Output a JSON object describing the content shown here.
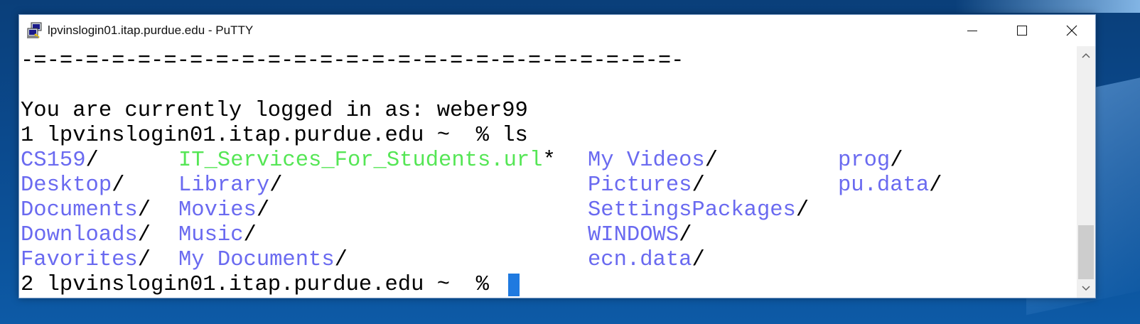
{
  "window": {
    "title": "lpvinslogin01.itap.purdue.edu - PuTTY"
  },
  "terminal": {
    "lines": [
      {
        "text": "-=-=-=-=-=-=-=-=-=-=-=-=-=-=-=-=-=-=-=-=-=-=-=-=-=-"
      },
      {
        "text": ""
      },
      {
        "text": "You are currently logged in as: weber99"
      },
      {
        "text": "1 lpvinslogin01.itap.purdue.edu ~  % ls"
      }
    ],
    "listing": [
      [
        "CS159",
        "IT_Services_For_Students.url",
        "My Videos",
        "prog"
      ],
      [
        "Desktop",
        "Library",
        "Pictures",
        "pu.data"
      ],
      [
        "Documents",
        "Movies",
        "SettingsPackages",
        ""
      ],
      [
        "Downloads",
        "Music",
        "WINDOWS",
        ""
      ],
      [
        "Favorites",
        "My Documents",
        "ecn.data",
        ""
      ]
    ],
    "suffix_slash": "/",
    "suffix_star": "*",
    "prompt2": "2 lpvinslogin01.itap.purdue.edu ~  % "
  },
  "colors": {
    "directory": "#6a6af0",
    "executable": "#55e655",
    "cursor": "#1f7ae0",
    "background": "#ffffff",
    "text": "#000000"
  },
  "icons": [
    "putty-icon",
    "minimize-icon",
    "maximize-icon",
    "close-icon",
    "scroll-up-icon",
    "scroll-down-icon"
  ]
}
